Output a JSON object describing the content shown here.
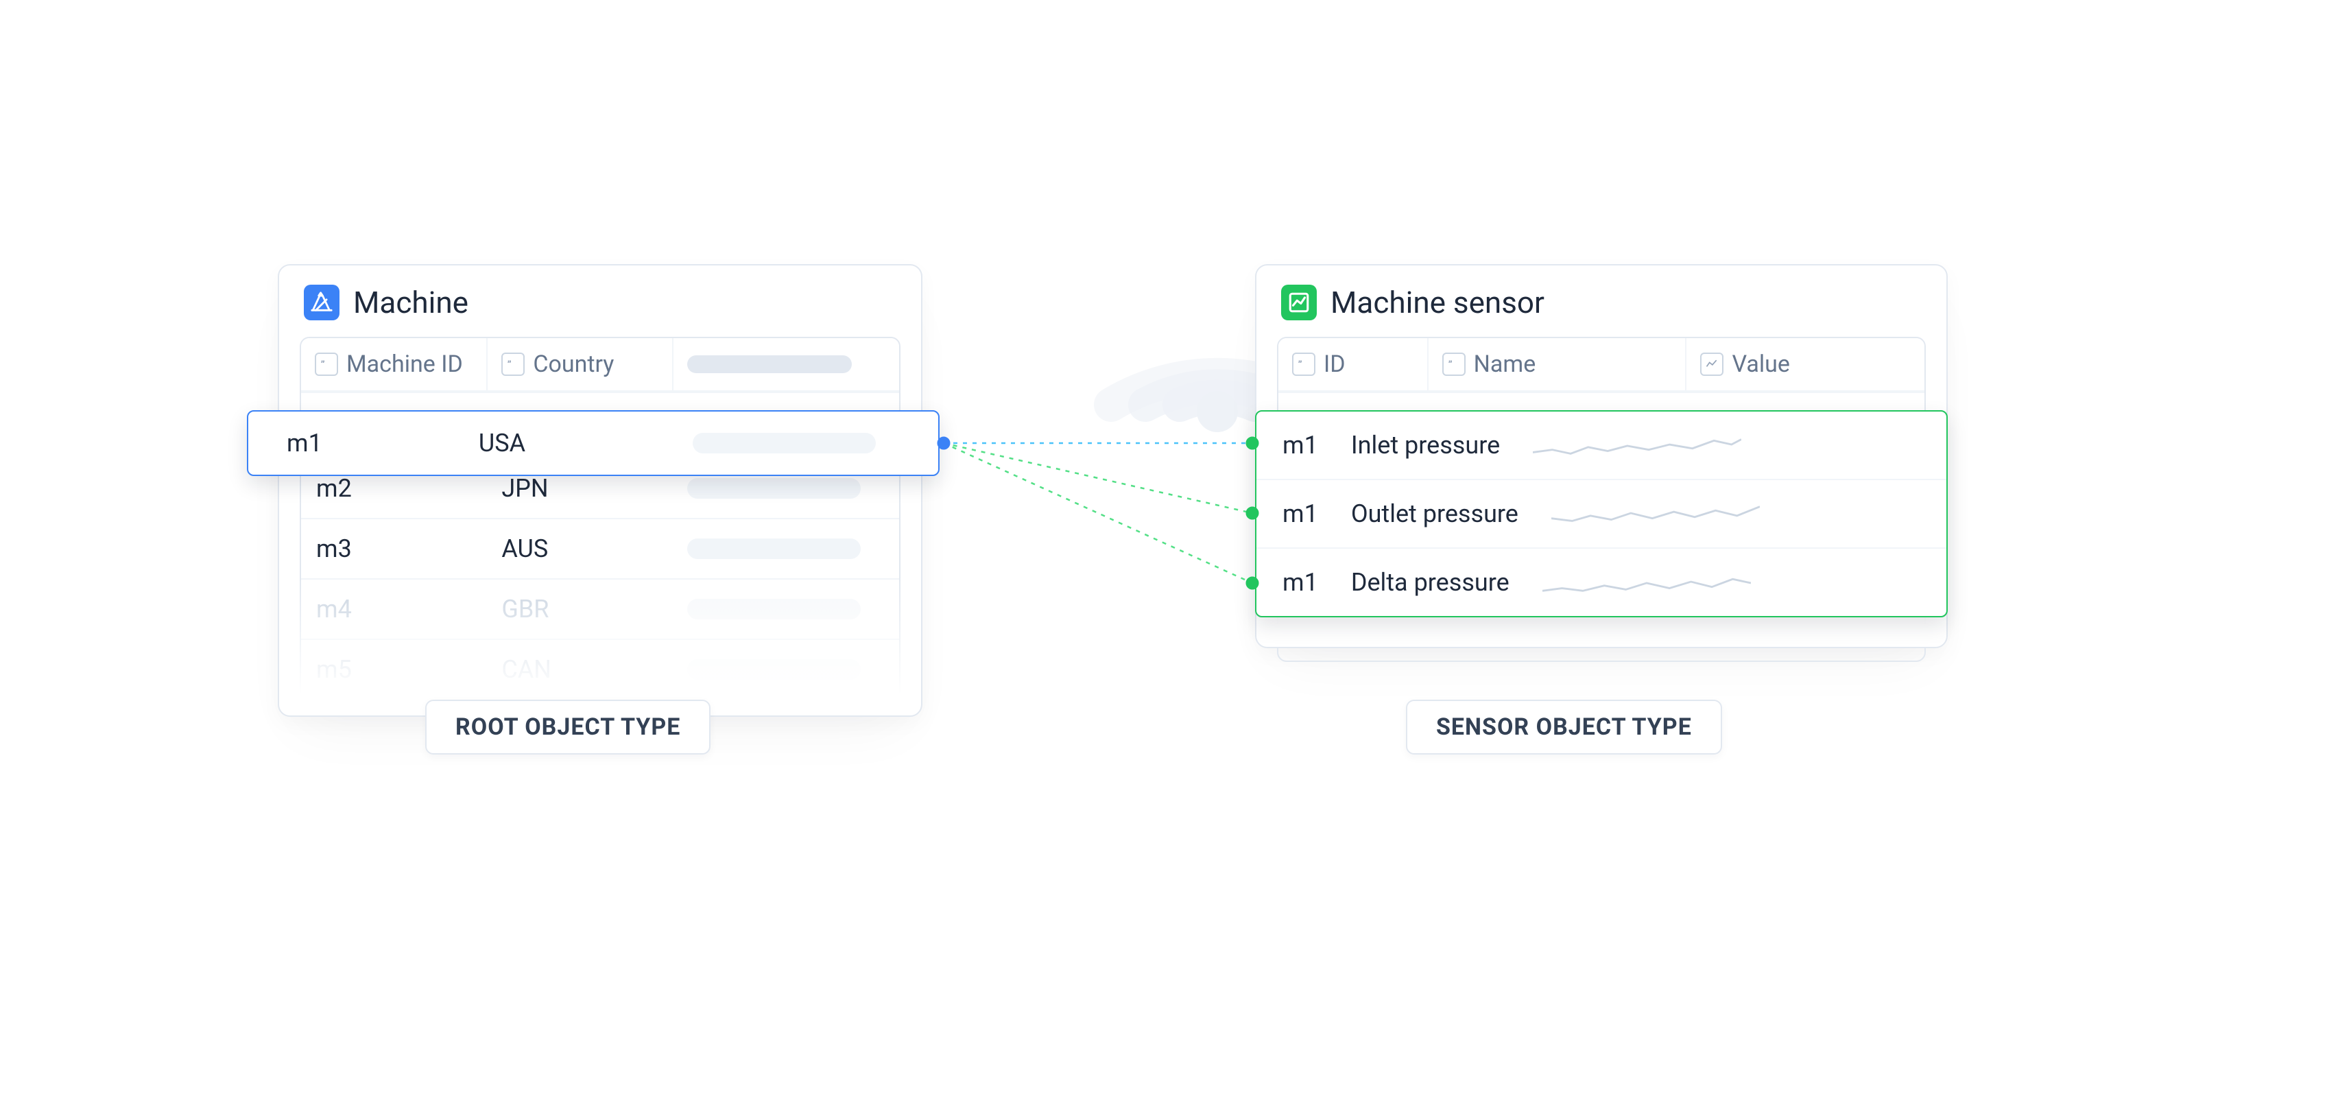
{
  "machine_panel": {
    "title": "Machine",
    "icon_name": "machine-icon",
    "columns": [
      "Machine ID",
      "Country"
    ],
    "rows": [
      {
        "id": "m1",
        "country": "USA",
        "highlight": true
      },
      {
        "id": "m2",
        "country": "JPN"
      },
      {
        "id": "m3",
        "country": "AUS"
      },
      {
        "id": "m4",
        "country": "GBR",
        "muted": true
      },
      {
        "id": "m5",
        "country": "CAN",
        "muted": true
      }
    ],
    "caption": "ROOT OBJECT TYPE"
  },
  "sensor_panel": {
    "title": "Machine sensor",
    "icon_name": "chart-icon",
    "columns": [
      "ID",
      "Name",
      "Value"
    ],
    "rows": [
      {
        "id": "m1",
        "name": "Inlet pressure",
        "highlight": true
      },
      {
        "id": "m1",
        "name": "Outlet pressure",
        "highlight": true
      },
      {
        "id": "m1",
        "name": "Delta pressure",
        "highlight": true
      }
    ],
    "caption": "SENSOR OBJECT TYPE"
  },
  "colors": {
    "root_accent": "#3b82f6",
    "sensor_accent": "#22c55e"
  }
}
